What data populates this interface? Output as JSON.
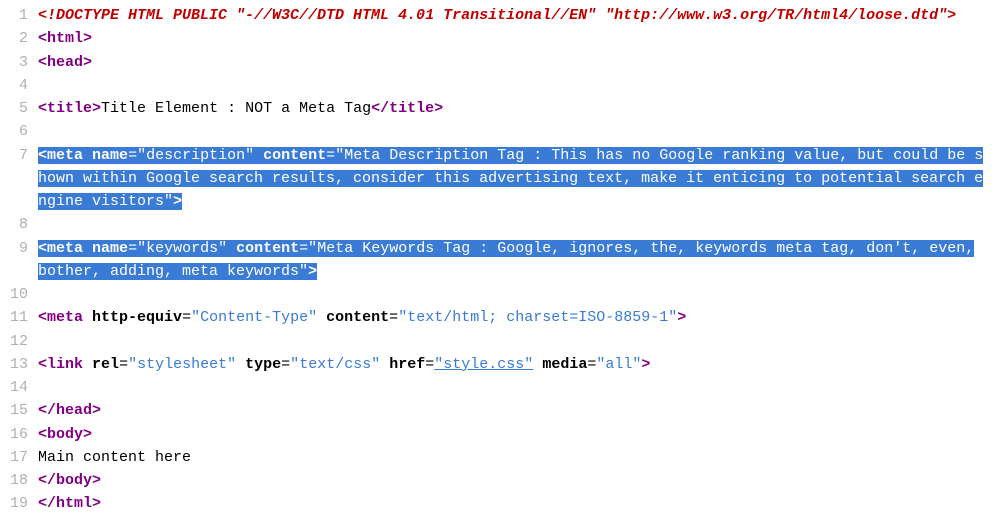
{
  "lines": {
    "l1": "<!DOCTYPE HTML PUBLIC \"-//W3C//DTD HTML 4.01 Transitional//EN\" \"http://www.w3.org/TR/html4/loose.dtd\">",
    "l5_title_text": "Title Element : NOT a Meta Tag",
    "l7_desc_value": "description",
    "l7_content_value": "Meta Description Tag : This has no Google ranking value, but could be shown within Google search results, consider this advertising text, make it enticing to potential search engine visitors",
    "l9_kw_value": "keywords",
    "l9_content_value": "Meta Keywords Tag : Google, ignores, the, keywords meta tag, don't, even, bother, adding, meta keywords",
    "l11_httpeq": "Content-Type",
    "l11_content": "text/html; charset=ISO-8859-1",
    "l13_rel": "stylesheet",
    "l13_type": "text/css",
    "l13_href": "style.css",
    "l13_media": "all",
    "l17_main": "Main content here"
  },
  "tokens": {
    "lt": "<",
    "gt": ">",
    "close": "</",
    "q": "\"",
    "eq": "=",
    "sp": " ",
    "html": "html",
    "head": "head",
    "title": "title",
    "meta": "meta",
    "link": "link",
    "body": "body",
    "name_attr": "name",
    "content_attr": "content",
    "httpequiv_attr": "http-equiv",
    "rel_attr": "rel",
    "type_attr": "type",
    "href_attr": "href",
    "media_attr": "media"
  },
  "linenos": {
    "n1": "1",
    "n2": "2",
    "n3": "3",
    "n4": "4",
    "n5": "5",
    "n6": "6",
    "n7": "7",
    "n8": "8",
    "n9": "9",
    "n10": "10",
    "n11": "11",
    "n12": "12",
    "n13": "13",
    "n14": "14",
    "n15": "15",
    "n16": "16",
    "n17": "17",
    "n18": "18",
    "n19": "19"
  }
}
